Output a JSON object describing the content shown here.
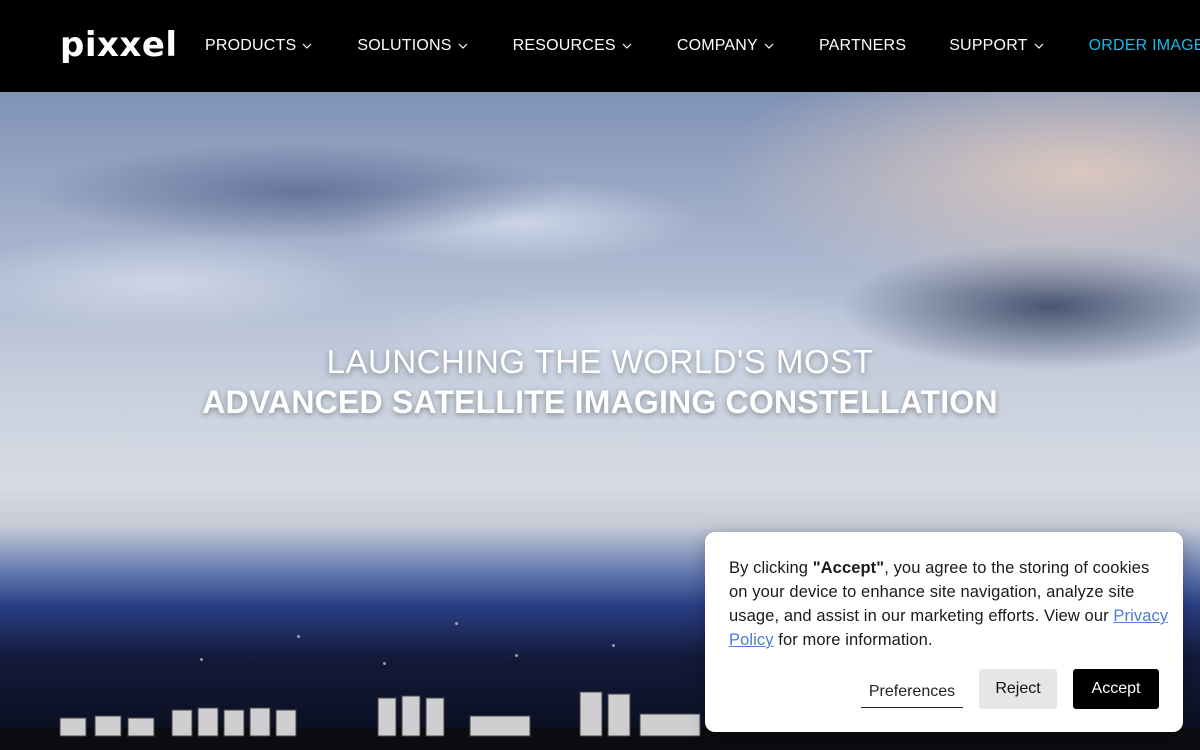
{
  "brand": {
    "logo_text": "pixxel",
    "accent_color": "#20b6e8"
  },
  "nav": {
    "items": [
      {
        "label": "PRODUCTS",
        "has_dropdown": true
      },
      {
        "label": "SOLUTIONS",
        "has_dropdown": true
      },
      {
        "label": "RESOURCES",
        "has_dropdown": true
      },
      {
        "label": "COMPANY",
        "has_dropdown": true
      },
      {
        "label": "PARTNERS",
        "has_dropdown": false
      },
      {
        "label": "SUPPORT",
        "has_dropdown": true
      }
    ],
    "cta_label": "ORDER IMAGERY"
  },
  "hero": {
    "line1": "LAUNCHING THE WORLD'S MOST",
    "line2": "ADVANCED SATELLITE IMAGING CONSTELLATION"
  },
  "cookie_banner": {
    "text_prefix": "By clicking ",
    "text_bold": "\"Accept\"",
    "text_middle": ", you agree to the storing of cookies on your device to enhance site navigation, analyze site usage, and assist in our marketing efforts. View our ",
    "link_label": "Privacy Policy",
    "text_suffix": " for more information.",
    "preferences_label": "Preferences",
    "reject_label": "Reject",
    "accept_label": "Accept"
  }
}
